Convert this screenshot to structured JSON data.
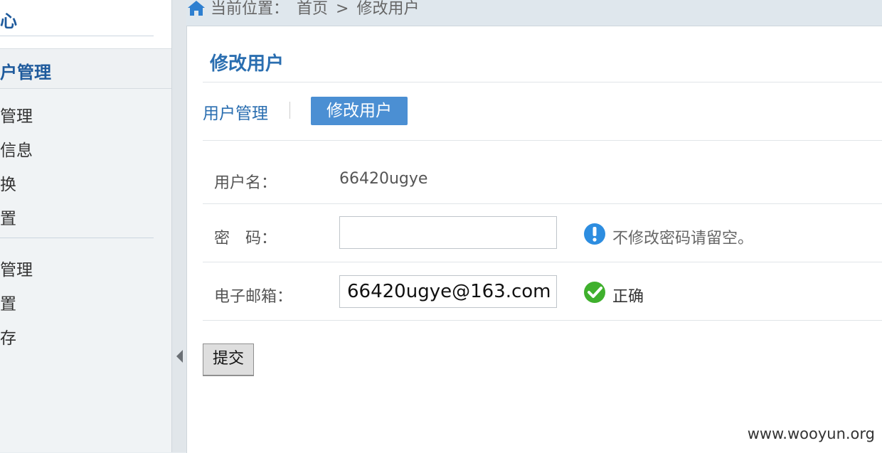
{
  "sidebar": {
    "header_title": "心",
    "section_label": "户管理",
    "items": [
      {
        "label": "管理"
      },
      {
        "label": "信息"
      },
      {
        "label": "换"
      },
      {
        "label": "置"
      },
      {
        "label": "管理"
      },
      {
        "label": "置"
      },
      {
        "label": "存"
      }
    ]
  },
  "breadcrumb": {
    "prefix": "当前位置：",
    "home": "首页",
    "separator": ">",
    "current": "修改用户"
  },
  "main": {
    "title": "修改用户",
    "tabs": [
      {
        "label": "用户管理"
      },
      {
        "label": "修改用户"
      }
    ],
    "form": {
      "username_label": "用户名：",
      "username_value": "66420ugye",
      "password_label": "密　码：",
      "password_value": "",
      "password_hint": "不修改密码请留空。",
      "email_label": "电子邮箱：",
      "email_value": "66420ugye@163.com",
      "email_status": "正确",
      "submit_label": "提交"
    }
  },
  "watermark": "www.wooyun.org",
  "icons": {
    "home": "home-icon",
    "info": "info-icon",
    "check": "check-icon",
    "collapse": "collapse-arrow-icon"
  },
  "colors": {
    "accent": "#2a6eb0",
    "tab_active": "#4b8fd3",
    "info": "#2d8de0",
    "ok": "#3fb02d"
  }
}
